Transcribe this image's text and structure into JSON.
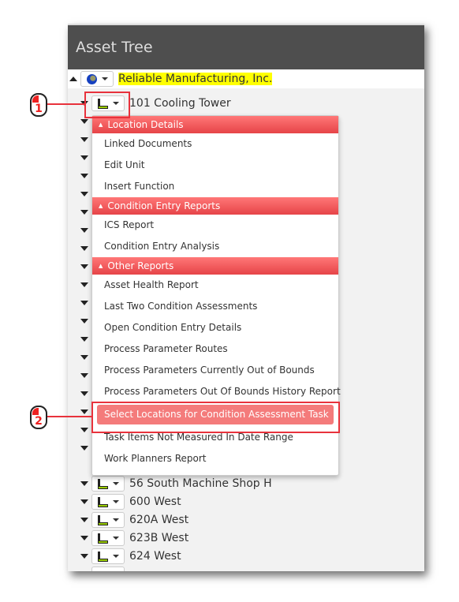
{
  "header": {
    "title": "Asset Tree"
  },
  "tree": {
    "root": {
      "label": "Reliable Manufacturing, Inc.",
      "icon": "globe-icon"
    },
    "selected": {
      "label": "101 Cooling Tower",
      "icon": "factory-icon"
    },
    "items": [
      {
        "label": "56 South Machine Shop H"
      },
      {
        "label": "600 West"
      },
      {
        "label": "620A West"
      },
      {
        "label": "623B West"
      },
      {
        "label": "624 West"
      }
    ]
  },
  "menu": {
    "sections": [
      {
        "title": "Location Details",
        "items": [
          "Linked Documents",
          "Edit Unit",
          "Insert Function"
        ]
      },
      {
        "title": "Condition Entry Reports",
        "items": [
          "ICS Report",
          "Condition Entry Analysis"
        ]
      },
      {
        "title": "Other Reports",
        "items": [
          "Asset Health Report",
          "Last Two Condition Assessments",
          "Open Condition Entry Details",
          "Process Parameter Routes",
          "Process Parameters Currently Out of Bounds",
          "Process Parameters Out Of Bounds History Report",
          "Select Locations for Condition Assessment Task",
          "Task Items Not Measured In Date Range",
          "Work Planners Report"
        ]
      }
    ],
    "selected_item": "Select Locations for Condition Assessment Task"
  },
  "callouts": [
    "1",
    "2"
  ],
  "colors": {
    "accent": "#e64448",
    "highlight": "#f47b7b",
    "header": "#4e4e4e",
    "root_highlight": "#ffff00"
  }
}
